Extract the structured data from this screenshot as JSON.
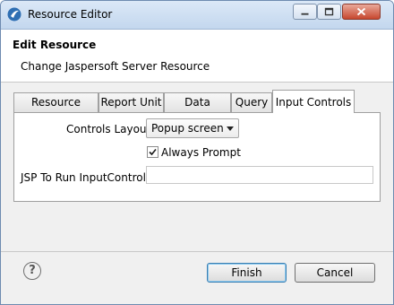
{
  "window": {
    "title": "Resource Editor",
    "icon": "jasper-app-icon"
  },
  "header": {
    "title": "Edit Resource",
    "subtitle": "Change Jaspersoft Server Resource"
  },
  "tabs": [
    {
      "label": "Resource Editor",
      "active": false
    },
    {
      "label": "Report Unit",
      "active": false
    },
    {
      "label": "Data Source",
      "active": false
    },
    {
      "label": "Query",
      "active": false
    },
    {
      "label": "Input Controls",
      "active": true
    }
  ],
  "form": {
    "controls_layout_label": "Controls Layout",
    "controls_layout_value": "Popup screen",
    "always_prompt_label": "Always Prompt",
    "always_prompt_checked": true,
    "jsp_label": "JSP To Run InputControls",
    "jsp_value": ""
  },
  "footer": {
    "help_icon": "?",
    "finish_label": "Finish",
    "cancel_label": "Cancel"
  }
}
